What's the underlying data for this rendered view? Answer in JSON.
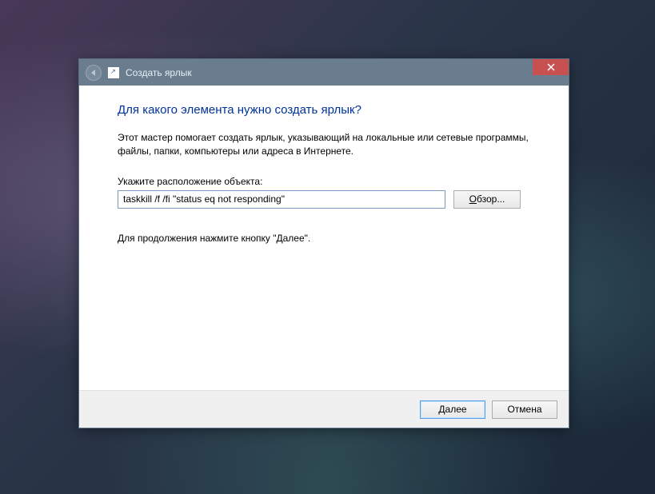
{
  "titlebar": {
    "title": "Создать ярлык"
  },
  "content": {
    "heading": "Для какого элемента нужно создать ярлык?",
    "description": "Этот мастер помогает создать ярлык, указывающий на локальные или сетевые программы, файлы, папки, компьютеры или адреса в Интернете.",
    "path_label": "Укажите расположение объекта:",
    "path_value": "taskkill /f /fi \"status eq not responding\"",
    "browse_label": "Обзор...",
    "continue_text": "Для продолжения нажмите кнопку \"Далее\"."
  },
  "footer": {
    "next_label": "Далее",
    "cancel_label": "Отмена"
  }
}
